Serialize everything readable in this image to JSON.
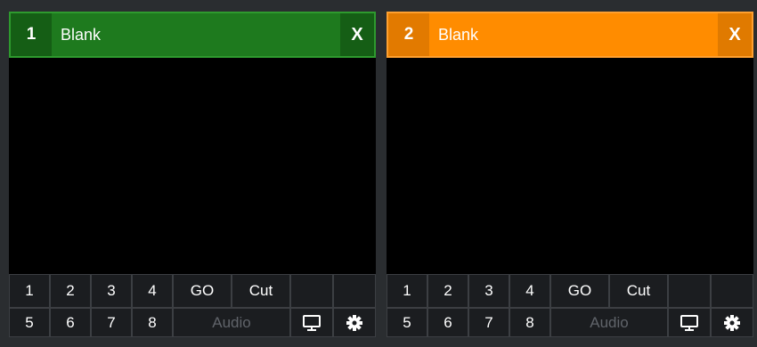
{
  "panels": [
    {
      "number": "1",
      "title": "Blank",
      "close_label": "X",
      "accent": "#1e7a1e",
      "row1": [
        "1",
        "2",
        "3",
        "4",
        "GO",
        "Cut"
      ],
      "row2": [
        "5",
        "6",
        "7",
        "8"
      ],
      "audio_label": "Audio",
      "icons": [
        "monitor-icon",
        "gear-icon"
      ]
    },
    {
      "number": "2",
      "title": "Blank",
      "close_label": "X",
      "accent": "#ff8c00",
      "row1": [
        "1",
        "2",
        "3",
        "4",
        "GO",
        "Cut"
      ],
      "row2": [
        "5",
        "6",
        "7",
        "8"
      ],
      "audio_label": "Audio",
      "icons": [
        "monitor-icon",
        "gear-icon"
      ]
    }
  ]
}
